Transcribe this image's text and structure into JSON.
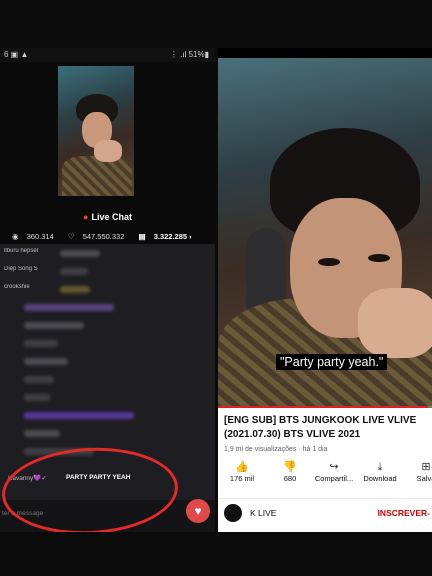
{
  "left": {
    "status": {
      "left_icons": "6 ▣ ▲",
      "right": "⋮ .ıl 51%▮"
    },
    "chat_title": "Live Chat",
    "stats": {
      "views": "360.314",
      "likes": "547.550.332",
      "comments": "3.322.285"
    },
    "chat_rows": [
      {
        "name": "llburu hepsebtr"
      },
      {
        "name": "Diệp Song Son"
      },
      {
        "name": "crookshie"
      },
      {
        "name": ""
      },
      {
        "name": ""
      },
      {
        "name": ""
      },
      {
        "name": ""
      },
      {
        "name": ""
      },
      {
        "name": ""
      },
      {
        "name": ""
      },
      {
        "name": ""
      },
      {
        "name": ""
      }
    ],
    "highlight": {
      "name": "Kavanny💜✓",
      "message": "PARTY PARTY YEAH"
    },
    "input_placeholder": "ter a message",
    "heart_icon": "heart-icon"
  },
  "right": {
    "subtitle": "\"Party party yeah.\"",
    "progress": 0.98,
    "title": "[ENG SUB] BTS JUNGKOOK LIVE VLIVE (2021.07.30) BTS VLIVE 2021",
    "meta": "1,9 mi de visualizações · há 1 dia",
    "actions": [
      {
        "icon": "thumbs-up-icon",
        "glyph": "👍",
        "label": "176 mil"
      },
      {
        "icon": "thumbs-down-icon",
        "glyph": "👎",
        "label": "680"
      },
      {
        "icon": "share-icon",
        "glyph": "↪",
        "label": "Compartil..."
      },
      {
        "icon": "download-icon",
        "glyph": "⤓",
        "label": "Download"
      },
      {
        "icon": "save-icon",
        "glyph": "⊞",
        "label": "Salva"
      }
    ],
    "channel": {
      "name": "K LIVE",
      "subscribe": "INSCREVER-"
    }
  },
  "colors": {
    "accent_red": "#e02020",
    "heart_button": "#e0494b",
    "annotation_circle": "#e32a2a"
  }
}
